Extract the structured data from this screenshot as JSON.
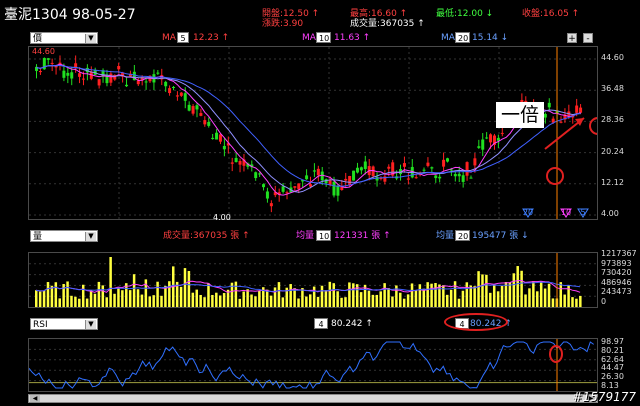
{
  "header": {
    "title": "臺泥1304 98-05-27",
    "open_label": "開盤:12.50 ↑",
    "change_label": "漲跌:3.90",
    "high_label": "最高:16.60 ↑",
    "volume_label": "成交量:367035 ↑",
    "low_label": "最低:12.00 ↓",
    "close_label": "收盤:16.05 ↑"
  },
  "price_panel": {
    "selector": "價",
    "ma1_label": "MA",
    "ma1_period": "5",
    "ma1_value": "12.23 ↑",
    "ma2_label": "MA",
    "ma2_period": "10",
    "ma2_value": "11.63 ↑",
    "ma3_label": "MA",
    "ma3_period": "20",
    "ma3_value": "15.14 ↓",
    "plus": "+",
    "minus": "-",
    "high_mark": "44.60",
    "low_mark": "4.00",
    "annotation": "一倍",
    "axis_ticks": [
      "44.60",
      "36.48",
      "28.36",
      "20.24",
      "12.12",
      "4.00"
    ],
    "bottom_markers": [
      "20",
      "10",
      "5"
    ]
  },
  "volume_panel": {
    "selector": "量",
    "vol_label": "成交量:367035 張 ↑",
    "avg1_label": "均量",
    "avg1_period": "10",
    "avg1_value": "121331 張 ↑",
    "avg2_label": "均量",
    "avg2_period": "20",
    "avg2_value": "195477 張 ↓",
    "axis_ticks": [
      "1217367",
      "973893",
      "730420",
      "486946",
      "243473",
      "0"
    ]
  },
  "rsi_panel": {
    "selector": "RSI",
    "period1": "4",
    "value1": "80.242 ↑",
    "period2": "4",
    "value2": "80.242 ↑",
    "axis_ticks": [
      "98.97",
      "80.21",
      "62.64",
      "44.47",
      "26.30",
      "8.13"
    ]
  },
  "watermark": "#1579177",
  "colors": {
    "up": "#ff2020",
    "down": "#20e020",
    "ma5": "#ff40ff",
    "ma10": "#9090ff",
    "ma20": "#4060ff",
    "volume": "#ffff40",
    "rsi": "#3070ff",
    "cursor": "#ff8000"
  }
}
